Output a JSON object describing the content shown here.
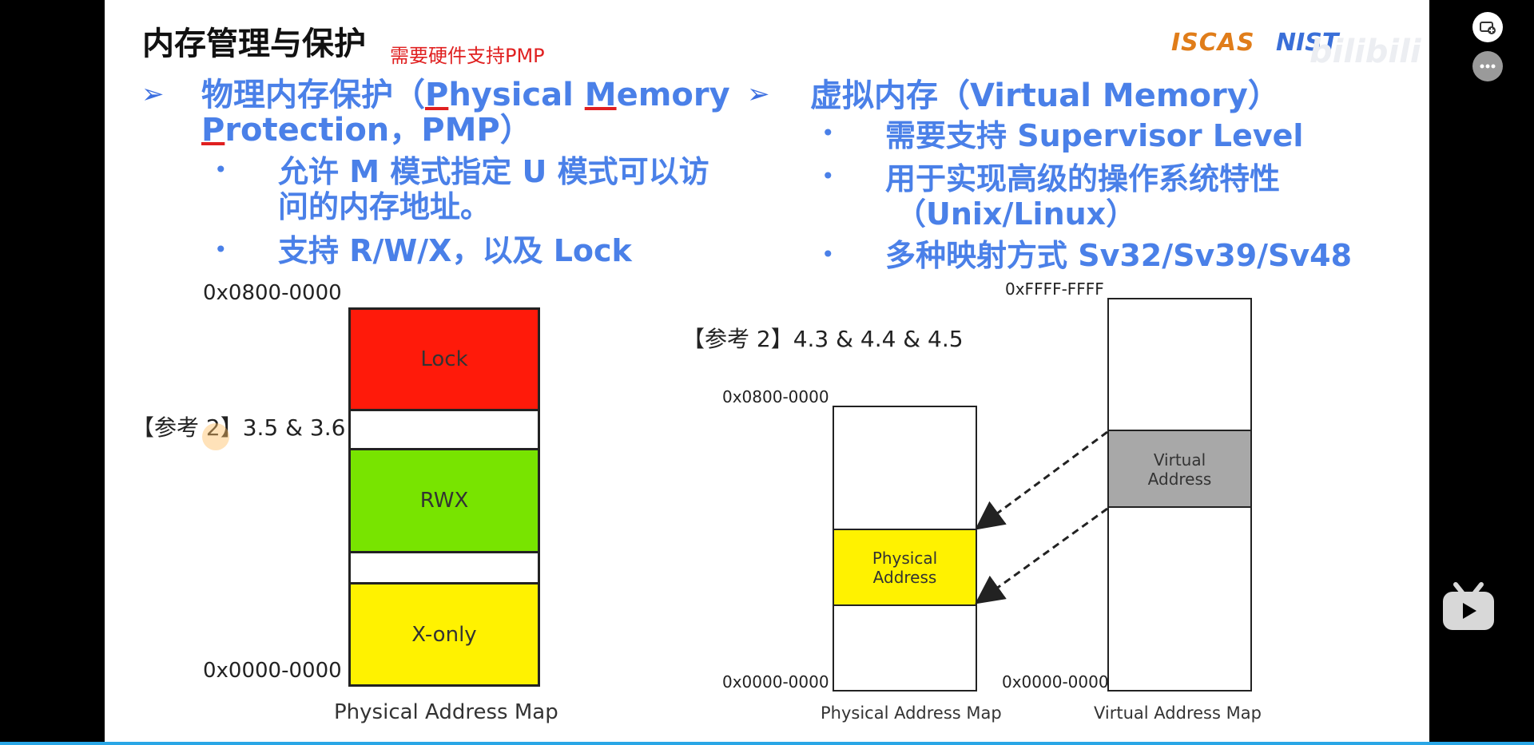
{
  "slide": {
    "title": "内存管理与保护",
    "subtitle": "需要硬件支持PMP",
    "logos": [
      "ISCAS",
      "NIST"
    ],
    "watermark": "bilibili"
  },
  "left": {
    "heading_parts": [
      "物理内存保护（",
      "P",
      "hysical ",
      "M",
      "emory"
    ],
    "heading_line2_parts": [
      "P",
      "rotection，PMP）"
    ],
    "bullet1_line1": "允许 M 模式指定 U 模式可以访",
    "bullet1_line2": "问的内存地址。",
    "bullet2": "支持 R/W/X，以及 Lock",
    "addr_top": "0x0800-0000",
    "addr_bottom": "0x0000-0000",
    "ref": "【参考 2】3.5 & 3.6",
    "regions": {
      "lock": "Lock",
      "rwx": "RWX",
      "xonly": "X-only"
    },
    "caption": "Physical Address Map"
  },
  "right": {
    "heading": "虚拟内存（Virtual Memory）",
    "bullet1": "需要支持 Supervisor Level",
    "bullet2_line1": "用于实现高级的操作系统特性",
    "bullet2_line2": "（Unix/Linux）",
    "bullet3": "多种映射方式 Sv32/Sv39/Sv48",
    "ref": "【参考 2】4.3 & 4.4 & 4.5",
    "phys_addr_top": "0x0800-0000",
    "phys_addr_bottom": "0x0000-0000",
    "virt_addr_top": "0xFFFF-FFFF",
    "virt_addr_bottom": "0x0000-0000",
    "physical_label": "Physical Address",
    "virtual_label": "Virtual Address",
    "phys_caption": "Physical Address Map",
    "virt_caption": "Virtual Address Map"
  },
  "colors": {
    "lock": "#ff1a0a",
    "rwx": "#78e400",
    "xonly": "#fff200",
    "phys": "#fff200",
    "virt": "#a8a8a8",
    "heading": "#4a80e8"
  },
  "icons": [
    "tv-add-icon",
    "more-icon",
    "bilibili-tv-icon",
    "arrow-bullet-icon"
  ]
}
